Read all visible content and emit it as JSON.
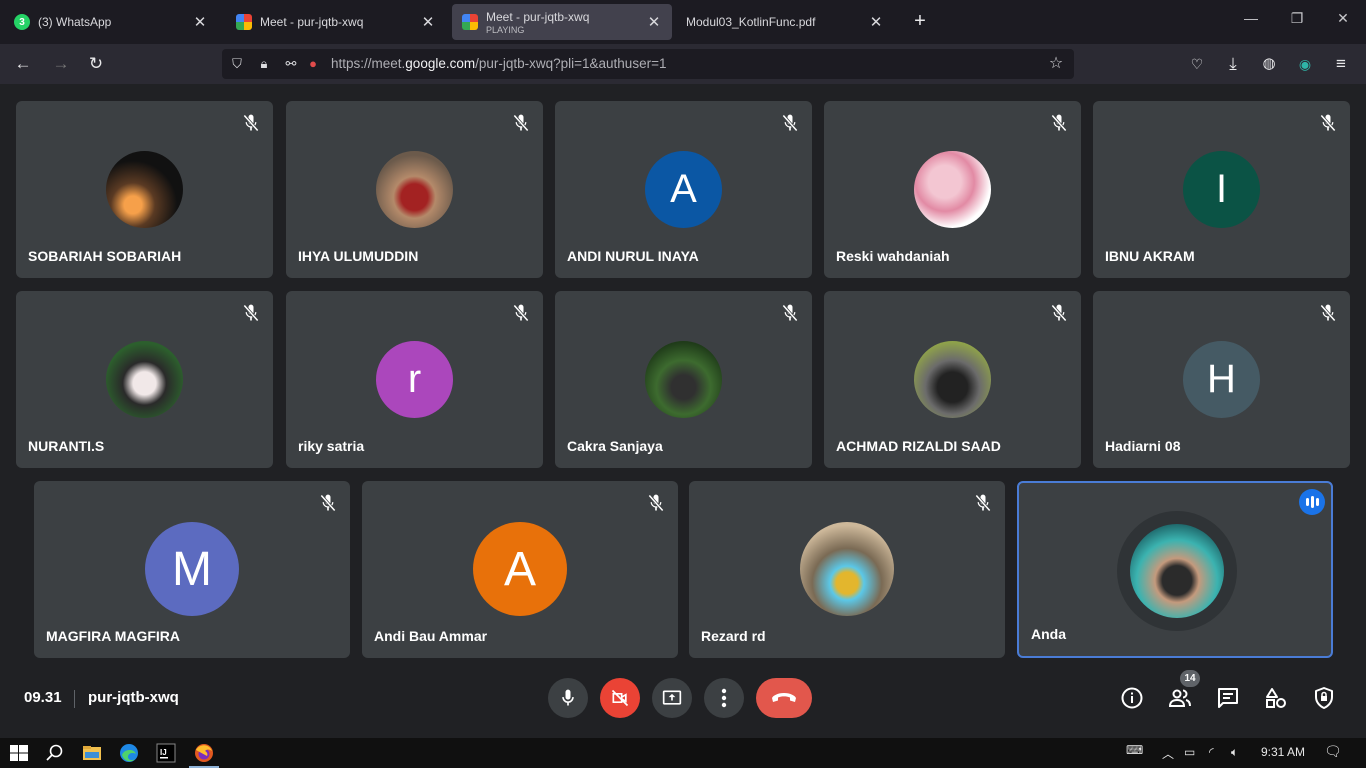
{
  "browser": {
    "tabs": [
      {
        "title": "(3) WhatsApp",
        "favicon": "whatsapp-icon",
        "favicon_text": "3",
        "active": false
      },
      {
        "title": "Meet - pur-jqtb-xwq",
        "favicon": "google-meet-icon",
        "active": false
      },
      {
        "title": "Meet - pur-jqtb-xwq",
        "subtitle": "PLAYING",
        "favicon": "google-meet-speaker-icon",
        "active": true
      },
      {
        "title": "Modul03_KotlinFunc.pdf",
        "favicon": "pdf-icon",
        "active": false
      }
    ],
    "new_tab_label": "+",
    "url": {
      "prefix": "https://meet.",
      "domain": "google.com",
      "rest": "/pur-jqtb-xwq?pli=1&authuser=1"
    }
  },
  "participants": [
    {
      "name": "SOBARIAH SOBARIAH",
      "avatar": "photo",
      "muted": true
    },
    {
      "name": "IHYA ULUMUDDIN",
      "avatar": "photo",
      "muted": true
    },
    {
      "name": "ANDI NURUL INAYA",
      "avatar": "letter",
      "letter": "A",
      "color": "#0b57a4",
      "muted": true
    },
    {
      "name": "Reski wahdaniah",
      "avatar": "photo",
      "muted": true
    },
    {
      "name": "IBNU AKRAM",
      "avatar": "letter",
      "letter": "I",
      "color": "#0b5345",
      "muted": true
    },
    {
      "name": "NURANTI.S",
      "avatar": "photo",
      "muted": true
    },
    {
      "name": "riky satria",
      "avatar": "letter",
      "letter": "r",
      "color": "#ab47bc",
      "muted": true
    },
    {
      "name": "Cakra Sanjaya",
      "avatar": "photo",
      "muted": true
    },
    {
      "name": "ACHMAD RIZALDI SAAD",
      "avatar": "photo",
      "muted": true
    },
    {
      "name": "Hadiarni 08",
      "avatar": "letter",
      "letter": "H",
      "color": "#455a64",
      "muted": true
    },
    {
      "name": "MAGFIRA MAGFIRA",
      "avatar": "letter",
      "letter": "M",
      "color": "#5c6bc0",
      "muted": true
    },
    {
      "name": "Andi Bau Ammar",
      "avatar": "letter",
      "letter": "A",
      "color": "#e8710a",
      "muted": true
    },
    {
      "name": "Rezard rd",
      "avatar": "photo",
      "muted": true
    },
    {
      "name": "Anda",
      "avatar": "photo",
      "muted": false,
      "speaking": true,
      "self": true
    }
  ],
  "meeting": {
    "time": "09.31",
    "code": "pur-jqtb-xwq",
    "participant_count": "14"
  },
  "controls": [
    "mic-button",
    "camera-off-button",
    "present-screen-button",
    "more-options-button",
    "leave-call-button"
  ],
  "right_controls": [
    "meeting-details-button",
    "people-button",
    "chat-button",
    "activities-button",
    "host-controls-button"
  ],
  "taskbar": {
    "clock": "9:31 AM",
    "apps": [
      "start-icon",
      "search-icon",
      "file-explorer-icon",
      "edge-icon",
      "intellij-icon",
      "firefox-icon"
    ]
  },
  "colors": {
    "meet_background": "#202124",
    "tile": "#3c4043",
    "leave_red": "#ea4335",
    "active_speaker": "#1a73e8"
  }
}
